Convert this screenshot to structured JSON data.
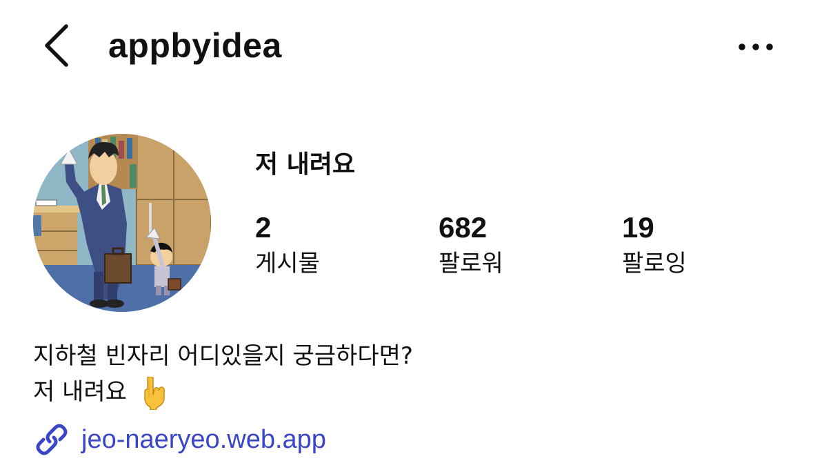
{
  "header": {
    "username": "appbyidea",
    "back_icon": "chevron-left-icon",
    "more_icon": "more-horizontal-icon"
  },
  "profile": {
    "display_name": "저 내려요",
    "avatar_description": "avatar-illustration",
    "stats": [
      {
        "count": "2",
        "label": "게시물"
      },
      {
        "count": "682",
        "label": "팔로워"
      },
      {
        "count": "19",
        "label": "팔로잉"
      }
    ],
    "bio": {
      "line1": "지하철 빈자리 어디있을지 궁금하다면?",
      "line2": "저 내려요",
      "emoji": "👇"
    },
    "link": {
      "text": "jeo-naeryeo.web.app",
      "icon": "link-icon",
      "color": "#3a45c8"
    }
  }
}
